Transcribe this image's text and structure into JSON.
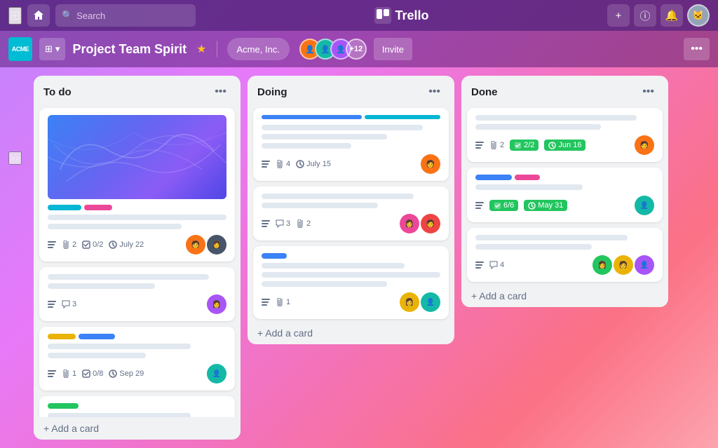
{
  "app": {
    "name": "Trello",
    "logo_text": "Trello"
  },
  "nav": {
    "search_placeholder": "Search",
    "add_label": "+",
    "info_label": "ⓘ",
    "bell_label": "🔔"
  },
  "board_header": {
    "acme_label": "ACME",
    "board_icon": "⊞",
    "board_dropdown": "▾",
    "title": "Project Team Spirit",
    "star_label": "★",
    "workspace_label": "Acme, Inc.",
    "member_count": "+12",
    "invite_label": "Invite",
    "more_label": "•••"
  },
  "sidebar": {
    "collapse_label": ">>"
  },
  "columns": [
    {
      "id": "todo",
      "title": "To do",
      "menu_label": "•••",
      "cards": [
        {
          "id": "card-1",
          "has_cover": true,
          "labels": [
            "cyan",
            "pink"
          ],
          "lines": [
            1.0,
            0.75
          ],
          "meta": {
            "description": true,
            "attachments": "2",
            "checklist": "0/2",
            "date": "July 22"
          },
          "avatars": [
            "orange",
            "dark"
          ]
        },
        {
          "id": "card-2",
          "labels": [],
          "lines": [
            0.9,
            0.6
          ],
          "meta": {
            "description": true,
            "comments": "3"
          },
          "avatars": [
            "purple"
          ]
        },
        {
          "id": "card-3",
          "labels": [
            "yellow",
            "blue"
          ],
          "lines": [
            0.8,
            0.55
          ],
          "meta": {
            "description": true,
            "attachments": "1",
            "checklist": "0/8",
            "date": "Sep 29"
          },
          "avatars": [
            "teal"
          ]
        },
        {
          "id": "card-4",
          "labels": [
            "green"
          ],
          "lines": [],
          "meta": {},
          "avatars": []
        }
      ],
      "add_card_label": "+ Add a card"
    },
    {
      "id": "doing",
      "title": "Doing",
      "menu_label": "•••",
      "cards": [
        {
          "id": "card-5",
          "has_progress": true,
          "labels": [],
          "lines": [
            0.9,
            0.7,
            0.5
          ],
          "meta": {
            "description": true,
            "attachments": "4",
            "date": "July 15"
          },
          "avatars": [
            "orange"
          ]
        },
        {
          "id": "card-6",
          "labels": [],
          "lines": [
            0.85,
            0.65
          ],
          "meta": {
            "description": true,
            "comments": "3",
            "attachments": "2"
          },
          "avatars": [
            "pink",
            "red"
          ]
        },
        {
          "id": "card-7",
          "labels": [
            "blue-sm"
          ],
          "lines": [
            0.8,
            1.0,
            0.7
          ],
          "meta": {
            "description": true,
            "attachments": "1"
          },
          "avatars": [
            "yellow",
            "teal"
          ]
        }
      ],
      "add_card_label": "+ Add a card"
    },
    {
      "id": "done",
      "title": "Done",
      "menu_label": "•••",
      "cards": [
        {
          "id": "card-8",
          "labels": [],
          "lines": [
            0.9,
            0.7
          ],
          "meta": {
            "description": true,
            "attachments": "2",
            "checklist_done": "2/2",
            "date_done": "Jun 16"
          },
          "avatars": [
            "orange"
          ]
        },
        {
          "id": "card-9",
          "labels": [
            "blue",
            "pink"
          ],
          "lines": [
            0.6
          ],
          "meta": {
            "description": true,
            "checklist_done": "6/6",
            "date_done": "May 31"
          },
          "avatars": [
            "teal"
          ]
        },
        {
          "id": "card-10",
          "labels": [],
          "lines": [
            0.85,
            0.65
          ],
          "meta": {
            "description": true,
            "comments": "4"
          },
          "avatars": [
            "green",
            "yellow",
            "purple"
          ]
        }
      ],
      "add_card_label": "+ Add a card"
    }
  ]
}
